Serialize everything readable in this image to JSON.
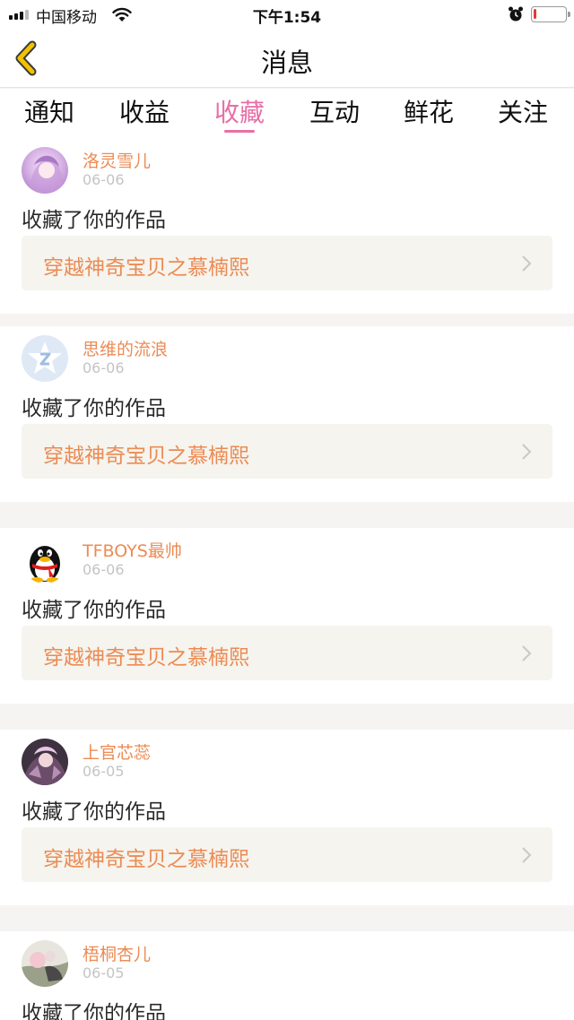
{
  "status_bar": {
    "carrier": "中国移动",
    "time": "下午1:54",
    "signal_icon": "signal-bars-icon",
    "wifi_icon": "wifi-icon",
    "alarm_icon": "alarm-clock-icon",
    "battery_icon": "battery-low-icon",
    "battery_level": 0.1
  },
  "nav": {
    "back_icon": "back-chevron-icon",
    "title": "消息"
  },
  "tabs": [
    {
      "label": "通知",
      "active": false
    },
    {
      "label": "收益",
      "active": false
    },
    {
      "label": "收藏",
      "active": true
    },
    {
      "label": "互动",
      "active": false
    },
    {
      "label": "鲜花",
      "active": false
    },
    {
      "label": "关注",
      "active": false
    }
  ],
  "messages": [
    {
      "user": "洛灵雪儿",
      "date": "06-06",
      "action": "收藏了你的作品",
      "work": "穿越神奇宝贝之慕楠熙",
      "avatar": "anime-girl-avatar"
    },
    {
      "user": "思维的流浪",
      "date": "06-06",
      "action": "收藏了你的作品",
      "work": "穿越神奇宝贝之慕楠熙",
      "avatar": "default-star-avatar"
    },
    {
      "user": "TFBOYS最帅",
      "date": "06-06",
      "action": "收藏了你的作品",
      "work": "穿越神奇宝贝之慕楠熙",
      "avatar": "qq-penguin-avatar"
    },
    {
      "user": "上官芯蕊",
      "date": "06-05",
      "action": "收藏了你的作品",
      "work": "穿越神奇宝贝之慕楠熙",
      "avatar": "anime-character-avatar"
    },
    {
      "user": "梧桐杏儿",
      "date": "06-05",
      "action": "收藏了你的作品",
      "work": "",
      "avatar": "anime-art-avatar"
    }
  ],
  "colors": {
    "accent_pink": "#e76fa6",
    "link_orange": "#ec8b54",
    "back_yellow": "#f2c200"
  }
}
